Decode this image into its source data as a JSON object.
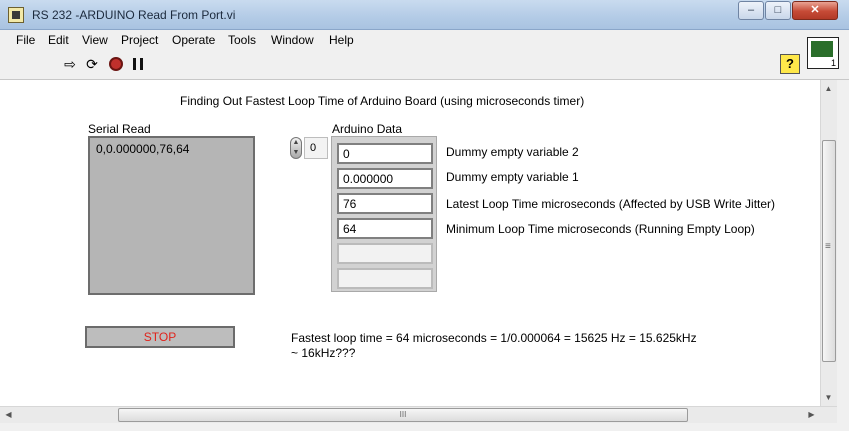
{
  "window": {
    "title": "RS 232 -ARDUINO Read From Port.vi",
    "minimize_glyph": "–",
    "maximize_glyph": "□",
    "close_glyph": "✕"
  },
  "menu": [
    "File",
    "Edit",
    "View",
    "Project",
    "Operate",
    "Tools",
    "Window",
    "Help"
  ],
  "toolbar": {
    "run_glyph": "⇨",
    "run_continuously_glyph": "⟳",
    "help_label": "?",
    "vi_icon_number": "1"
  },
  "panel": {
    "heading": "Finding Out Fastest Loop Time of Arduino Board (using microseconds timer)",
    "serial_read": {
      "label": "Serial Read",
      "value": "0,0.000000,76,64"
    },
    "arduino_data": {
      "label": "Arduino Data",
      "index": "0",
      "elements": [
        "0",
        "0.000000",
        "76",
        "64",
        "",
        ""
      ]
    },
    "descriptions": [
      "Dummy empty variable 2",
      "Dummy empty variable 1",
      "Latest Loop Time  microseconds (Affected by USB Write Jitter)",
      "Minimum Loop Time microseconds (Running Empty Loop)"
    ],
    "stop_label": "STOP",
    "result_line1": "Fastest loop time = 64 microseconds = 1/0.000064 = 15625 Hz = 15.625kHz",
    "result_line2": "~ 16kHz???"
  },
  "scrollbars": {
    "up_glyph": "▲",
    "down_glyph": "▼",
    "left_glyph": "◀",
    "right_glyph": "▶",
    "grip_v": "≡",
    "grip_h": "III"
  },
  "colors": {
    "stop_text": "#e0231b",
    "title_bar": "#b3cbe6"
  }
}
